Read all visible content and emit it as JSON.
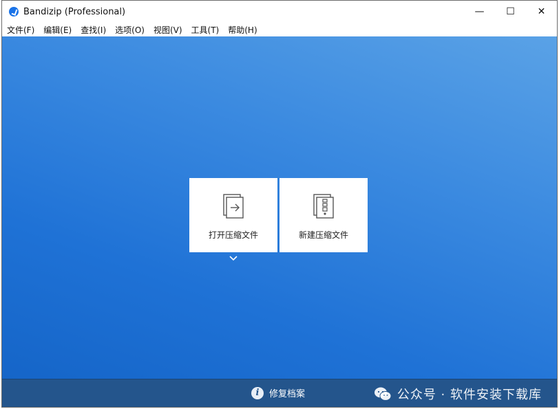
{
  "window": {
    "title": "Bandizip (Professional)",
    "controls": {
      "minimize": "—",
      "maximize": "☐",
      "close": "✕"
    }
  },
  "menu": [
    "文件(F)",
    "编辑(E)",
    "查找(I)",
    "选项(O)",
    "视图(V)",
    "工具(T)",
    "帮助(H)"
  ],
  "main": {
    "open_archive_label": "打开压缩文件",
    "new_archive_label": "新建压缩文件"
  },
  "footer": {
    "repair_label": "修复档案",
    "info_glyph": "i"
  },
  "watermark": {
    "text": "公众号 · 软件安装下载库"
  },
  "colors": {
    "brand": "#1a73e8",
    "content_bg_light": "#5aa2e6",
    "content_bg_dark": "#1565c8",
    "footer_bg": "#24558c"
  }
}
